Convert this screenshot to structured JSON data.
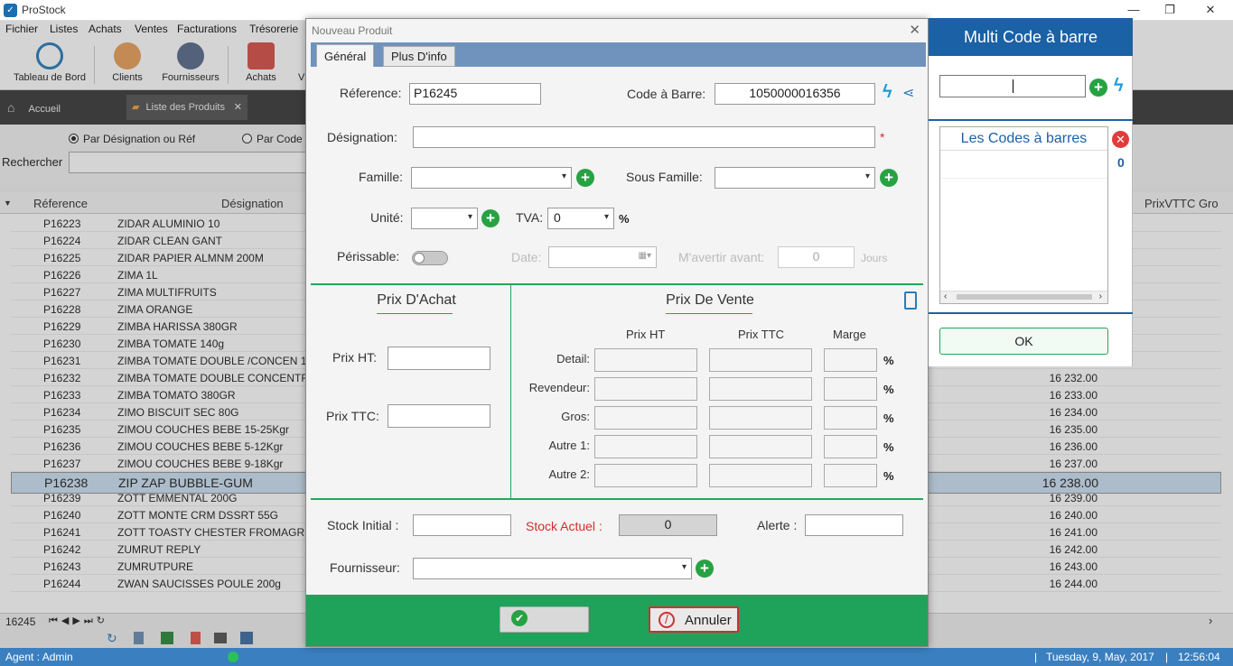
{
  "window": {
    "title": "ProStock",
    "min": "—",
    "restore": "❐",
    "close": "✕"
  },
  "menu": [
    "Fichier",
    "Listes",
    "Achats",
    "Ventes",
    "Facturations",
    "Trésorerie"
  ],
  "toolbar": {
    "dashboard": "Tableau de Bord",
    "clients": "Clients",
    "suppliers": "Fournisseurs",
    "purchases": "Achats",
    "next_partial": "V"
  },
  "tabs": {
    "home": "Accueil",
    "products": "Liste des Produits",
    "close": "✕"
  },
  "search": {
    "opt1": "Par Désignation ou Réf",
    "opt2": "Par Code",
    "label": "Rechercher"
  },
  "grid": {
    "headers": {
      "ref": "Réference",
      "designation": "Désignation",
      "price": "PrixVTTC Gro"
    },
    "rows": [
      {
        "ref": "P16223",
        "des": "ZIDAR ALUMINIO  10",
        "price": ""
      },
      {
        "ref": "P16224",
        "des": "ZIDAR CLEAN  GANT",
        "price": ""
      },
      {
        "ref": "P16225",
        "des": "ZIDAR PAPIER ALMNM 200M",
        "price": ""
      },
      {
        "ref": "P16226",
        "des": "ZIMA 1L",
        "price": ""
      },
      {
        "ref": "P16227",
        "des": "ZIMA MULTIFRUITS",
        "price": ""
      },
      {
        "ref": "P16228",
        "des": "ZIMA ORANGE",
        "price": ""
      },
      {
        "ref": "P16229",
        "des": "ZIMBA HARISSA 380GR",
        "price": ""
      },
      {
        "ref": "P16230",
        "des": "ZIMBA TOMATE 140g",
        "price": ""
      },
      {
        "ref": "P16231",
        "des": "ZIMBA TOMATE DOUBLE /CONCEN 1",
        "price": ""
      },
      {
        "ref": "P16232",
        "des": "ZIMBA TOMATE DOUBLE CONCENTR",
        "price": "16 232.00"
      },
      {
        "ref": "P16233",
        "des": "ZIMBA TOMATO 380GR",
        "price": "16 233.00"
      },
      {
        "ref": "P16234",
        "des": "ZIMO BISCUIT SEC 80G",
        "price": "16 234.00"
      },
      {
        "ref": "P16235",
        "des": "ZIMOU COUCHES BEBE 15-25Kgr",
        "price": "16 235.00"
      },
      {
        "ref": "P16236",
        "des": "ZIMOU COUCHES BEBE 5-12Kgr",
        "price": "16 236.00"
      },
      {
        "ref": "P16237",
        "des": "ZIMOU COUCHES BEBE 9-18Kgr",
        "price": "16 237.00"
      },
      {
        "ref": "P16238",
        "des": "ZIP ZAP BUBBLE-GUM",
        "price": "16 238.00"
      },
      {
        "ref": "P16239",
        "des": "ZOTT EMMENTAL 200G",
        "price": "16 239.00"
      },
      {
        "ref": "P16240",
        "des": "ZOTT MONTE CRM DSSRT 55G",
        "price": "16 240.00"
      },
      {
        "ref": "P16241",
        "des": "ZOTT TOASTY CHESTER FROMAGR",
        "price": "16 241.00"
      },
      {
        "ref": "P16242",
        "des": "ZUMRUT REPLY",
        "price": "16 242.00"
      },
      {
        "ref": "P16243",
        "des": "ZUMRUTPURE",
        "price": "16 243.00"
      },
      {
        "ref": "P16244",
        "des": "ZWAN SAUCISSES POULE 200g",
        "price": "16 244.00"
      }
    ],
    "selected_index": 15
  },
  "pager": {
    "count": "16245"
  },
  "status": {
    "agent": "Agent : Admin",
    "date": "Tuesday, 9,  May, 2017",
    "time": "12:56:04"
  },
  "dialog": {
    "title": "Nouveau Produit",
    "close": "✕",
    "tab_general": "Général",
    "tab_more": "Plus D'info",
    "ref_label": "Réference:",
    "ref_value": "P16245",
    "barcode_label": "Code à Barre:",
    "barcode_value": "1050000016356",
    "designation_label": "Désignation:",
    "required_mark": "*",
    "famille_label": "Famille:",
    "sousfamille_label": "Sous Famille:",
    "unite_label": "Unité:",
    "tva_label": "TVA:",
    "tva_value": "0",
    "pct": "%",
    "perissable_label": "Périssable:",
    "date_label": "Date:",
    "avertir_label": "M'avertir avant:",
    "avertir_value": "0",
    "jours_label": "Jours",
    "achat_title": "Prix D'Achat",
    "prixht_label": "Prix HT:",
    "prixttc_label": "Prix TTC:",
    "vente_title": "Prix De Vente",
    "col_ht": "Prix HT",
    "col_ttc": "Prix TTC",
    "col_marge": "Marge",
    "rows": [
      "Detail:",
      "Revendeur:",
      "Gros:",
      "Autre 1:",
      "Autre 2:"
    ],
    "stock_initial_label": "Stock Initial :",
    "stock_actuel_label": "Stock Actuel :",
    "stock_actuel_value": "0",
    "alerte_label": "Alerte :",
    "fournisseur_label": "Fournisseur:",
    "save_icon": "✔",
    "cancel_label": "Annuler"
  },
  "multicode": {
    "title": "Multi Code à barre",
    "list_title": "Les Codes à barres",
    "count": "0",
    "ok_label": "OK"
  },
  "colors": {
    "accent_green": "#1fa259",
    "brand_blue": "#1b61a5",
    "status_blue": "#3a7fc0",
    "tab_blue": "#6f93bd"
  }
}
